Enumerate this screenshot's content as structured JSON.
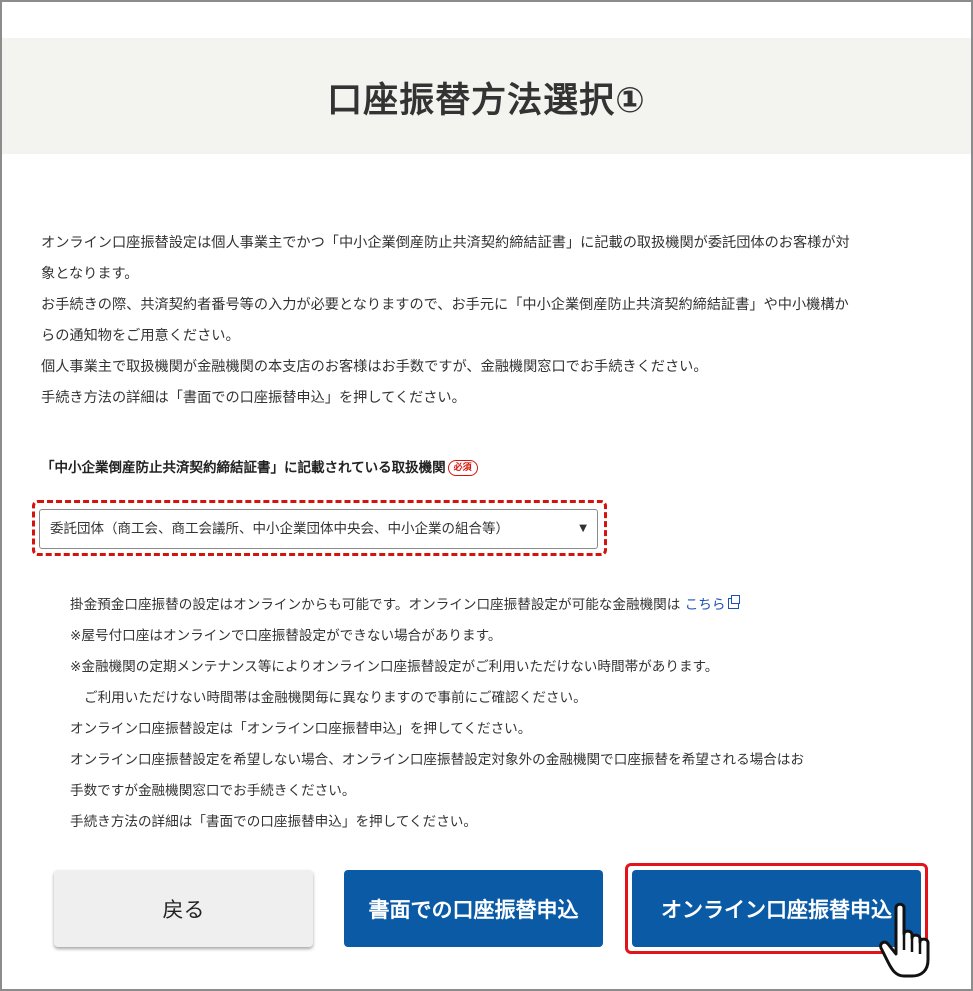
{
  "page": {
    "title": "口座振替方法選択①"
  },
  "intro": {
    "lines": [
      "オンライン口座振替設定は個人事業主でかつ「中小企業倒産防止共済契約締結証書」に記載の取扱機関が委託団体のお客様が対",
      "象となります。",
      "お手続きの際、共済契約者番号等の入力が必要となりますので、お手元に「中小企業倒産防止共済契約締結証書」や中小機構か",
      "らの通知物をご用意ください。",
      "個人事業主で取扱機関が金融機関の本支店のお客様はお手数ですが、金融機関窓口でお手続きください。",
      "手続き方法の詳細は「書面での口座振替申込」を押してください。"
    ]
  },
  "form": {
    "label": "「中小企業倒産防止共済契約締結証書」に記載されている取扱機関",
    "required_badge": "必須",
    "select_value": "委託団体（商工会、商工会議所、中小企業団体中央会、中小企業の組合等）"
  },
  "notes": {
    "line1_text": "掛金預金口座振替の設定はオンラインからも可能です。オンライン口座振替設定が可能な金融機関は",
    "line1_link": "こちら",
    "lines": [
      "※屋号付口座はオンラインで口座振替設定ができない場合があります。",
      "※金融機関の定期メンテナンス等によりオンライン口座振替設定がご利用いただけない時間帯があります。",
      "ご利用いただけない時間帯は金融機関毎に異なりますので事前にご確認ください。",
      "オンライン口座振替設定は「オンライン口座振替申込」を押してください。",
      "オンライン口座振替設定を希望しない場合、オンライン口座振替設定対象外の金融機関で口座振替を希望される場合はお",
      "手数ですが金融機関窓口でお手続きください。",
      "手続き方法の詳細は「書面での口座振替申込」を押してください。"
    ]
  },
  "buttons": {
    "back": "戻る",
    "paper": "書面での口座振替申込",
    "online": "オンライン口座振替申込"
  },
  "colors": {
    "primary": "#0a5aa6",
    "highlight_red": "#e3121b",
    "title_band": "#f3f3ef",
    "link": "#1f4fb5"
  },
  "icons": {
    "external_link": "external-link-icon",
    "dropdown_arrow": "triangle-down",
    "cursor": "hand-pointer"
  }
}
